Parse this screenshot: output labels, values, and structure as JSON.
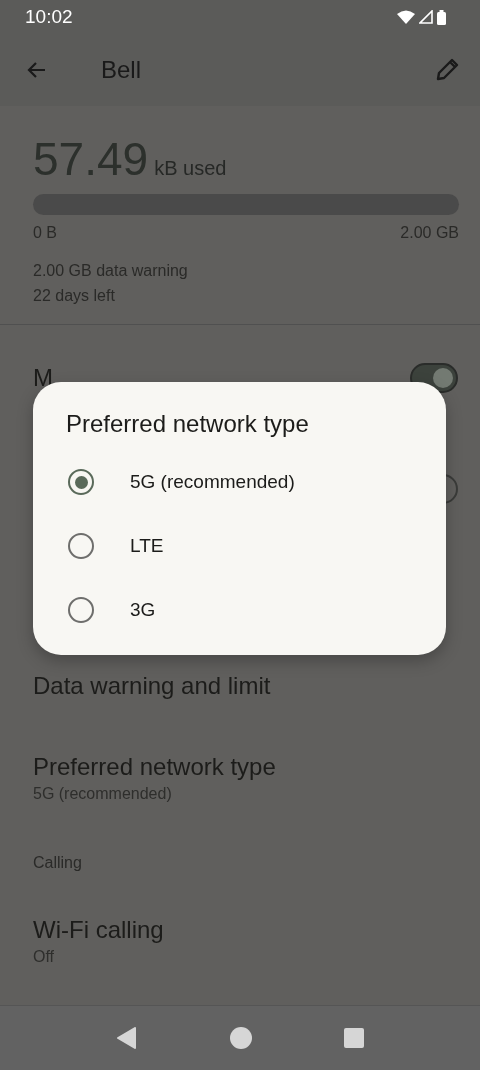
{
  "status_bar": {
    "time": "10:02"
  },
  "app_bar": {
    "title": "Bell"
  },
  "usage": {
    "amount": "57.49",
    "unit": "kB used",
    "min_label": "0 B",
    "max_label": "2.00 GB",
    "warning": "2.00 GB data warning",
    "days_left": "22 days left"
  },
  "toggle_rows": [
    {
      "title": "M",
      "on": true
    },
    {
      "on": false
    }
  ],
  "rows": [
    {
      "kind": "item",
      "title": "Data warning and limit"
    },
    {
      "kind": "item",
      "title": "Preferred network type",
      "summary": "5G (recommended)"
    },
    {
      "kind": "header",
      "title": "Calling"
    },
    {
      "kind": "item",
      "title": "Wi-Fi calling",
      "summary": "Off"
    }
  ],
  "dialog": {
    "title": "Preferred network type",
    "options": [
      {
        "label": "5G (recommended)",
        "selected": true
      },
      {
        "label": "LTE",
        "selected": false
      },
      {
        "label": "3G",
        "selected": false
      }
    ]
  }
}
